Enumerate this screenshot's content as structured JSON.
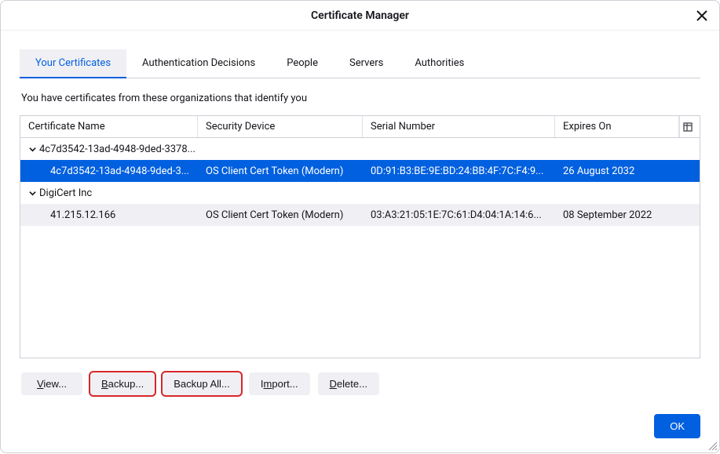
{
  "title": "Certificate Manager",
  "tabs": [
    {
      "label": "Your Certificates",
      "active": true
    },
    {
      "label": "Authentication Decisions",
      "active": false
    },
    {
      "label": "People",
      "active": false
    },
    {
      "label": "Servers",
      "active": false
    },
    {
      "label": "Authorities",
      "active": false
    }
  ],
  "description": "You have certificates from these organizations that identify you",
  "columns": [
    "Certificate Name",
    "Security Device",
    "Serial Number",
    "Expires On"
  ],
  "groups": [
    {
      "name": "4c7d3542-13ad-4948-9ded-3378...",
      "expanded": true,
      "rows": [
        {
          "selected": true,
          "cells": [
            "4c7d3542-13ad-4948-9ded-3...",
            "OS Client Cert Token (Modern)",
            "0D:91:B3:BE:9E:BD:24:BB:4F:7C:F4:9...",
            "26 August 2032"
          ]
        }
      ]
    },
    {
      "name": "DigiCert Inc",
      "expanded": true,
      "rows": [
        {
          "selected": false,
          "alt": true,
          "cells": [
            "41.215.12.166",
            "OS Client Cert Token (Modern)",
            "03:A3:21:05:1E:7C:61:D4:04:1A:14:6...",
            "08 September 2022"
          ]
        }
      ]
    }
  ],
  "buttons": {
    "view": "View...",
    "backup": "Backup...",
    "backup_all": "Backup All...",
    "import": "Import...",
    "delete": "Delete..."
  },
  "ok": "OK"
}
